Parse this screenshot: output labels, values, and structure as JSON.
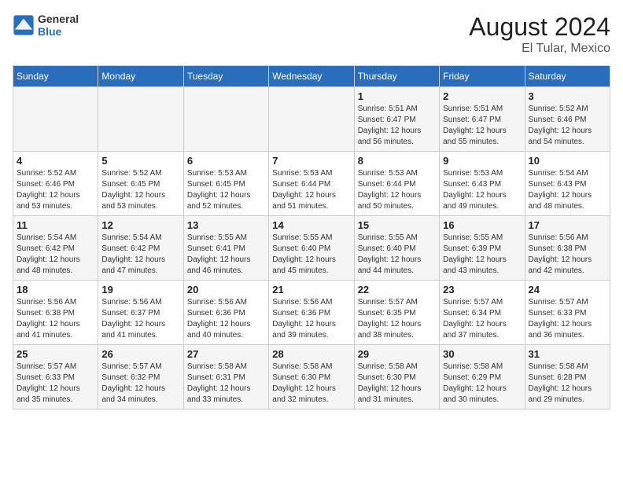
{
  "header": {
    "logo_general": "General",
    "logo_blue": "Blue",
    "main_title": "August 2024",
    "subtitle": "El Tular, Mexico"
  },
  "weekdays": [
    "Sunday",
    "Monday",
    "Tuesday",
    "Wednesday",
    "Thursday",
    "Friday",
    "Saturday"
  ],
  "weeks": [
    [
      {
        "day": "",
        "info": ""
      },
      {
        "day": "",
        "info": ""
      },
      {
        "day": "",
        "info": ""
      },
      {
        "day": "",
        "info": ""
      },
      {
        "day": "1",
        "info": "Sunrise: 5:51 AM\nSunset: 6:47 PM\nDaylight: 12 hours and 56 minutes."
      },
      {
        "day": "2",
        "info": "Sunrise: 5:51 AM\nSunset: 6:47 PM\nDaylight: 12 hours and 55 minutes."
      },
      {
        "day": "3",
        "info": "Sunrise: 5:52 AM\nSunset: 6:46 PM\nDaylight: 12 hours and 54 minutes."
      }
    ],
    [
      {
        "day": "4",
        "info": "Sunrise: 5:52 AM\nSunset: 6:46 PM\nDaylight: 12 hours and 53 minutes."
      },
      {
        "day": "5",
        "info": "Sunrise: 5:52 AM\nSunset: 6:45 PM\nDaylight: 12 hours and 53 minutes."
      },
      {
        "day": "6",
        "info": "Sunrise: 5:53 AM\nSunset: 6:45 PM\nDaylight: 12 hours and 52 minutes."
      },
      {
        "day": "7",
        "info": "Sunrise: 5:53 AM\nSunset: 6:44 PM\nDaylight: 12 hours and 51 minutes."
      },
      {
        "day": "8",
        "info": "Sunrise: 5:53 AM\nSunset: 6:44 PM\nDaylight: 12 hours and 50 minutes."
      },
      {
        "day": "9",
        "info": "Sunrise: 5:53 AM\nSunset: 6:43 PM\nDaylight: 12 hours and 49 minutes."
      },
      {
        "day": "10",
        "info": "Sunrise: 5:54 AM\nSunset: 6:43 PM\nDaylight: 12 hours and 48 minutes."
      }
    ],
    [
      {
        "day": "11",
        "info": "Sunrise: 5:54 AM\nSunset: 6:42 PM\nDaylight: 12 hours and 48 minutes."
      },
      {
        "day": "12",
        "info": "Sunrise: 5:54 AM\nSunset: 6:42 PM\nDaylight: 12 hours and 47 minutes."
      },
      {
        "day": "13",
        "info": "Sunrise: 5:55 AM\nSunset: 6:41 PM\nDaylight: 12 hours and 46 minutes."
      },
      {
        "day": "14",
        "info": "Sunrise: 5:55 AM\nSunset: 6:40 PM\nDaylight: 12 hours and 45 minutes."
      },
      {
        "day": "15",
        "info": "Sunrise: 5:55 AM\nSunset: 6:40 PM\nDaylight: 12 hours and 44 minutes."
      },
      {
        "day": "16",
        "info": "Sunrise: 5:55 AM\nSunset: 6:39 PM\nDaylight: 12 hours and 43 minutes."
      },
      {
        "day": "17",
        "info": "Sunrise: 5:56 AM\nSunset: 6:38 PM\nDaylight: 12 hours and 42 minutes."
      }
    ],
    [
      {
        "day": "18",
        "info": "Sunrise: 5:56 AM\nSunset: 6:38 PM\nDaylight: 12 hours and 41 minutes."
      },
      {
        "day": "19",
        "info": "Sunrise: 5:56 AM\nSunset: 6:37 PM\nDaylight: 12 hours and 41 minutes."
      },
      {
        "day": "20",
        "info": "Sunrise: 5:56 AM\nSunset: 6:36 PM\nDaylight: 12 hours and 40 minutes."
      },
      {
        "day": "21",
        "info": "Sunrise: 5:56 AM\nSunset: 6:36 PM\nDaylight: 12 hours and 39 minutes."
      },
      {
        "day": "22",
        "info": "Sunrise: 5:57 AM\nSunset: 6:35 PM\nDaylight: 12 hours and 38 minutes."
      },
      {
        "day": "23",
        "info": "Sunrise: 5:57 AM\nSunset: 6:34 PM\nDaylight: 12 hours and 37 minutes."
      },
      {
        "day": "24",
        "info": "Sunrise: 5:57 AM\nSunset: 6:33 PM\nDaylight: 12 hours and 36 minutes."
      }
    ],
    [
      {
        "day": "25",
        "info": "Sunrise: 5:57 AM\nSunset: 6:33 PM\nDaylight: 12 hours and 35 minutes."
      },
      {
        "day": "26",
        "info": "Sunrise: 5:57 AM\nSunset: 6:32 PM\nDaylight: 12 hours and 34 minutes."
      },
      {
        "day": "27",
        "info": "Sunrise: 5:58 AM\nSunset: 6:31 PM\nDaylight: 12 hours and 33 minutes."
      },
      {
        "day": "28",
        "info": "Sunrise: 5:58 AM\nSunset: 6:30 PM\nDaylight: 12 hours and 32 minutes."
      },
      {
        "day": "29",
        "info": "Sunrise: 5:58 AM\nSunset: 6:30 PM\nDaylight: 12 hours and 31 minutes."
      },
      {
        "day": "30",
        "info": "Sunrise: 5:58 AM\nSunset: 6:29 PM\nDaylight: 12 hours and 30 minutes."
      },
      {
        "day": "31",
        "info": "Sunrise: 5:58 AM\nSunset: 6:28 PM\nDaylight: 12 hours and 29 minutes."
      }
    ]
  ]
}
